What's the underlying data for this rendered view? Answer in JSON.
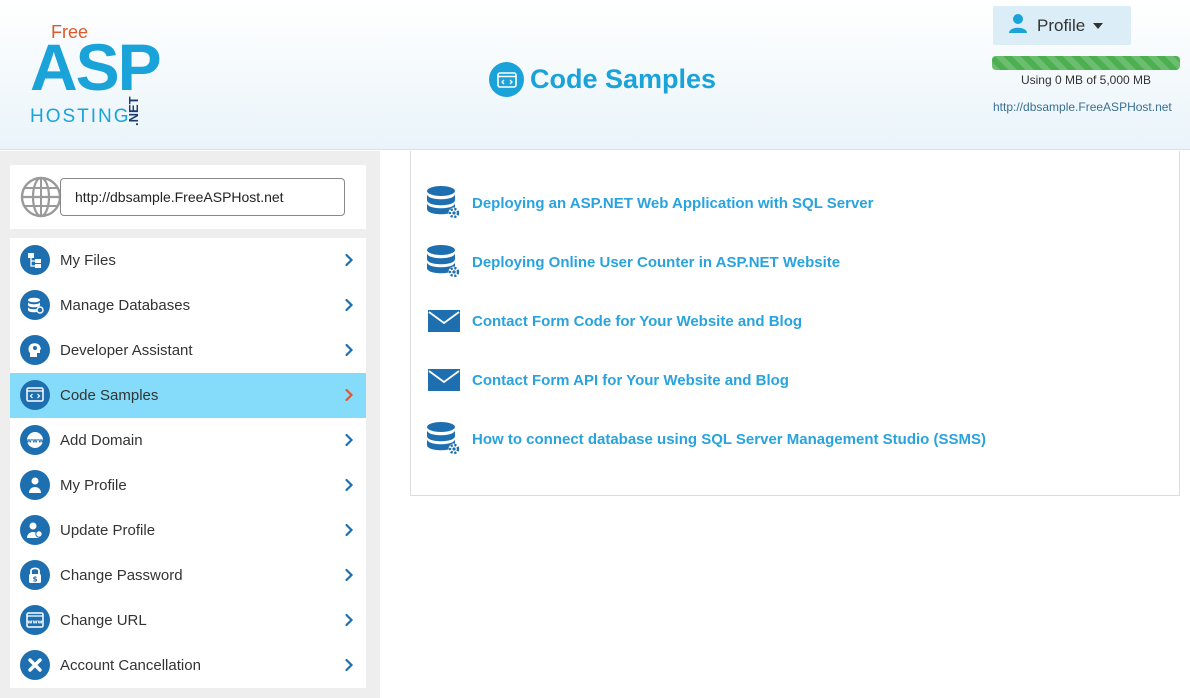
{
  "header": {
    "logo": {
      "free": "Free",
      "asp": "ASP",
      "hosting": "HOSTING",
      "net": ".NET"
    },
    "page_title": "Code Samples",
    "page_title_icon": "code-window-icon",
    "profile_label": "Profile",
    "usage_text": "Using 0 MB of 5,000 MB",
    "usage_fraction": 0,
    "site_url": "http://dbsample.FreeASPHost.net"
  },
  "sidebar": {
    "url_value": "http://dbsample.FreeASPHost.net",
    "items": [
      {
        "label": "My Files",
        "icon": "files-icon"
      },
      {
        "label": "Manage Databases",
        "icon": "database-icon"
      },
      {
        "label": "Developer Assistant",
        "icon": "head-icon"
      },
      {
        "label": "Code Samples",
        "icon": "code-icon",
        "active": true
      },
      {
        "label": "Add Domain",
        "icon": "www-icon"
      },
      {
        "label": "My Profile",
        "icon": "user-icon"
      },
      {
        "label": "Update Profile",
        "icon": "user-edit-icon"
      },
      {
        "label": "Change Password",
        "icon": "lock-icon"
      },
      {
        "label": "Change URL",
        "icon": "url-icon"
      },
      {
        "label": "Account Cancellation",
        "icon": "close-icon"
      }
    ]
  },
  "samples": [
    {
      "label": "Deploying an ASP.NET Web Application with SQL Server",
      "icon": "database-gear-icon"
    },
    {
      "label": "Deploying Online User Counter in ASP.NET Website",
      "icon": "database-gear-icon"
    },
    {
      "label": "Contact Form Code for Your Website and Blog",
      "icon": "envelope-icon"
    },
    {
      "label": "Contact Form API for Your Website and Blog",
      "icon": "envelope-icon"
    },
    {
      "label": "How to connect database using SQL Server Management Studio (SSMS)",
      "icon": "database-gear-icon"
    }
  ],
  "colors": {
    "accent": "#1aa3d9",
    "active_item": "#84dcfa",
    "icon_blue": "#1e6fb0",
    "active_chevron": "#e0582a",
    "usage_bar": "#4caf50"
  }
}
